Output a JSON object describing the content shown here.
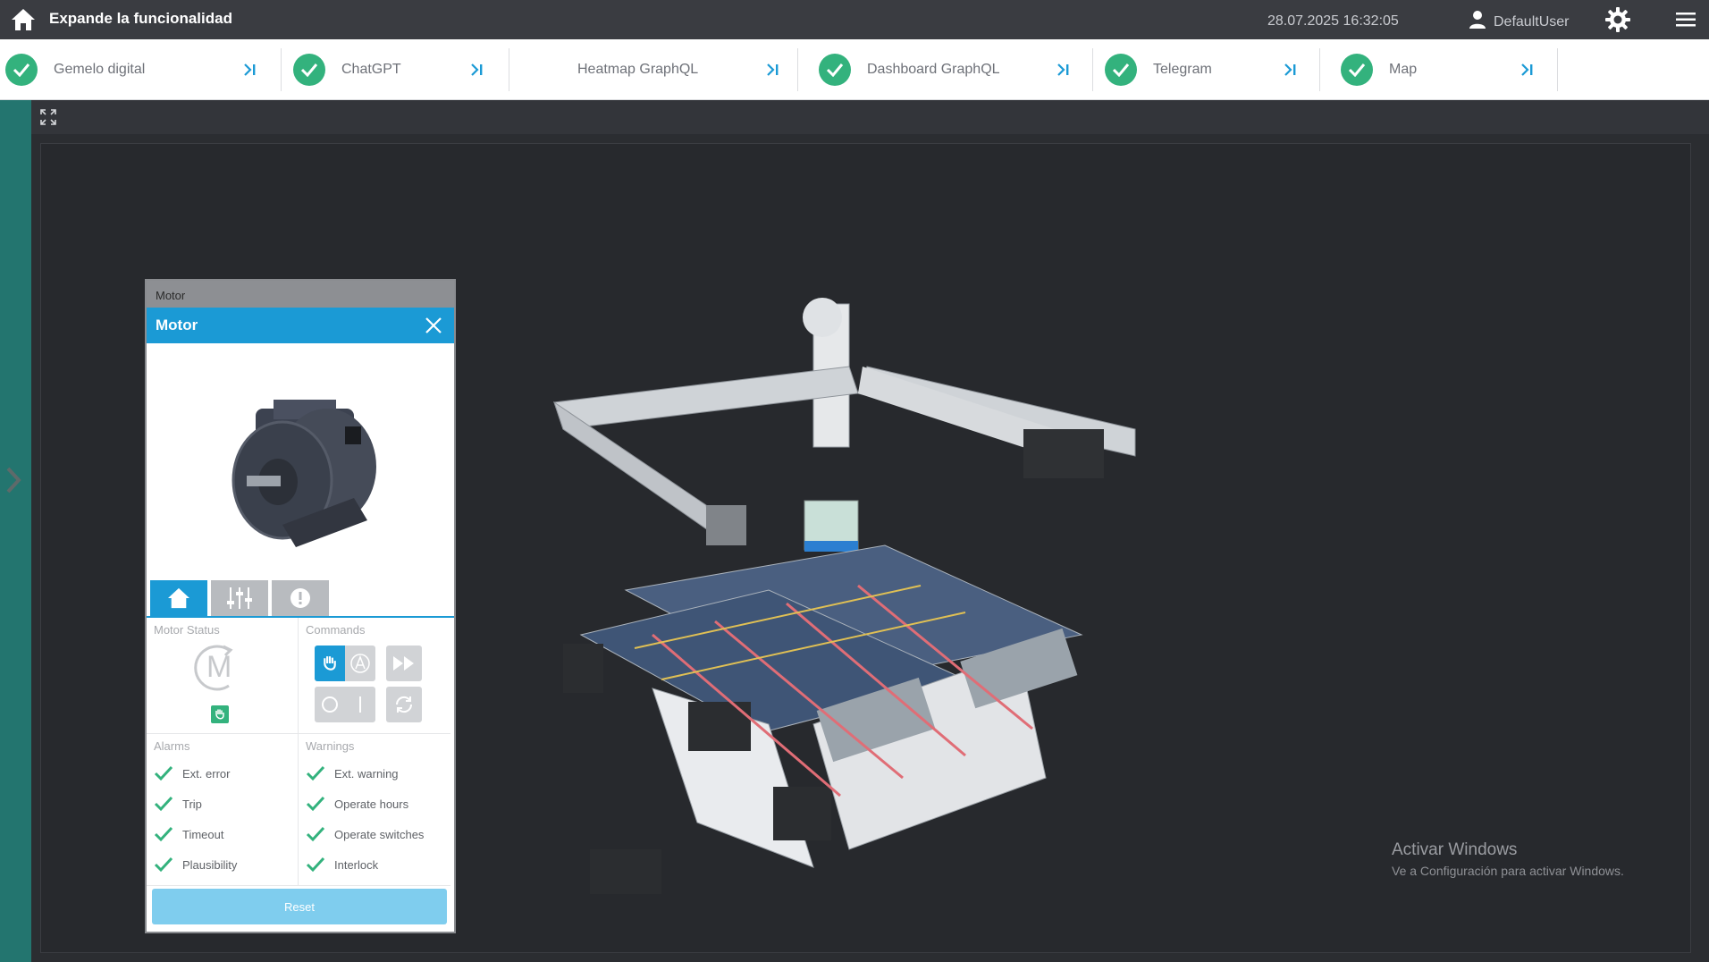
{
  "header": {
    "title": "Expande la funcionalidad",
    "datetime": "28.07.2025 16:32:05",
    "user": "DefaultUser"
  },
  "tabs": [
    {
      "label": "Gemelo digital",
      "status": "ok"
    },
    {
      "label": "ChatGPT",
      "status": "ok"
    },
    {
      "label": "Heatmap GraphQL",
      "status": "none"
    },
    {
      "label": "Dashboard GraphQL",
      "status": "ok"
    },
    {
      "label": "Telegram",
      "status": "ok"
    },
    {
      "label": "Map",
      "status": "ok"
    }
  ],
  "panel": {
    "caption": "Motor",
    "title": "Motor",
    "motor_status_label": "Motor Status",
    "motor_letter": "M",
    "commands_label": "Commands",
    "alarms_label": "Alarms",
    "warnings_label": "Warnings",
    "alarms": [
      "Ext. error",
      "Trip",
      "Timeout",
      "Plausibility"
    ],
    "warnings": [
      "Ext. warning",
      "Operate hours",
      "Operate switches",
      "Interlock"
    ],
    "reset_label": "Reset"
  },
  "watermark": {
    "title": "Activar Windows",
    "subtitle": "Ve a Configuración para activar Windows."
  },
  "colors": {
    "accent": "#1b9ad5",
    "ok_green": "#33b27d",
    "side_rail": "#23756f",
    "topbar": "#3a3c41"
  }
}
